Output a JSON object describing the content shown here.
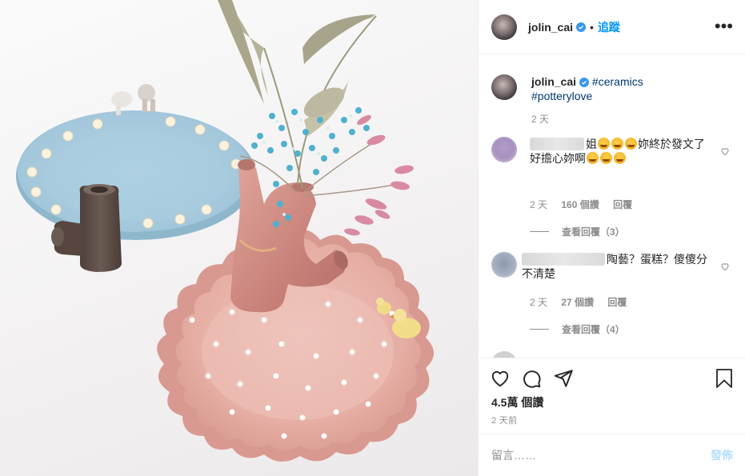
{
  "header": {
    "username": "jolin_cai",
    "separator": "•",
    "follow_label": "追蹤",
    "more_label": "•••"
  },
  "caption": {
    "username": "jolin_cai",
    "hashtag1": "#ceramics",
    "hashtag2": "#potterylove",
    "time": "2 天"
  },
  "comments": [
    {
      "text_start": "姐",
      "text_end": "妳終於發文了",
      "line2_start": "好擔心妳啊",
      "time": "2 天",
      "likes": "160 個讚",
      "reply_label": "回覆",
      "view_replies": "查看回覆（3）"
    },
    {
      "text_start": "陶藝？蛋糕？傻傻分不清楚",
      "time": "2 天",
      "likes": "27 個讚",
      "reply_label": "回覆",
      "view_replies": "查看回覆（4）"
    }
  ],
  "actions": {
    "views": "4.5萬 個讚",
    "posted": "2 天前"
  },
  "add_comment": {
    "placeholder": "留言……",
    "post_label": "發佈"
  },
  "colors": {
    "accent": "#0095f6",
    "verified": "#3897f0",
    "muted": "#8e8e8e",
    "post_disabled": "#b2dffc"
  },
  "icons": [
    "verified-badge-icon",
    "more-options-icon",
    "heart-icon",
    "comment-icon",
    "share-icon",
    "bookmark-icon"
  ]
}
